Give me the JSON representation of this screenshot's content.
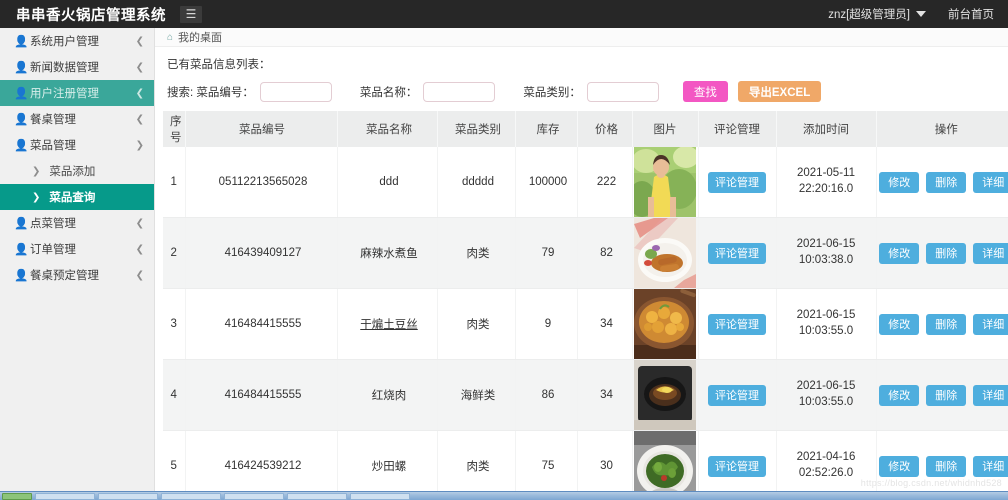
{
  "topbar": {
    "brand": "串串香火锅店管理系统",
    "menu_icon": "hamburger-icon",
    "user": "znz[超级管理员]",
    "front_page": "前台首页"
  },
  "sidebar": {
    "items": [
      {
        "label": "系统用户管理",
        "icon": "user-icon",
        "arrow": "❮",
        "state": "collapsed"
      },
      {
        "label": "新闻数据管理",
        "icon": "user-icon",
        "arrow": "❮",
        "state": "collapsed"
      },
      {
        "label": "用户注册管理",
        "icon": "user-icon",
        "arrow": "❮",
        "state": "hovered"
      },
      {
        "label": "餐桌管理",
        "icon": "user-icon",
        "arrow": "❮",
        "state": "collapsed"
      },
      {
        "label": "菜品管理",
        "icon": "user-icon",
        "arrow": "❯",
        "state": "expanded"
      }
    ],
    "sub_items": [
      {
        "label": "菜品添加",
        "arrow": "❯",
        "state": "normal"
      },
      {
        "label": "菜品查询",
        "arrow": "❯",
        "state": "active"
      }
    ],
    "items_after": [
      {
        "label": "点菜管理",
        "icon": "user-icon",
        "arrow": "❮",
        "state": "collapsed"
      },
      {
        "label": "订单管理",
        "icon": "user-icon",
        "arrow": "❮",
        "state": "collapsed"
      },
      {
        "label": "餐桌预定管理",
        "icon": "user-icon",
        "arrow": "❮",
        "state": "collapsed"
      }
    ]
  },
  "breadcrumb": {
    "home_icon": "home-icon",
    "text": "我的桌面"
  },
  "main": {
    "caption": "已有菜品信息列表：",
    "search": {
      "label_code": "搜索: 菜品编号：",
      "value_code": "",
      "label_name": "菜品名称：",
      "value_name": "",
      "label_type": "菜品类别：",
      "value_type": "",
      "find_label": "查找",
      "export_label": "导出EXCEL",
      "find_color": "#f357c3",
      "export_color": "#f0a868"
    },
    "table": {
      "headers": [
        "序号",
        "菜品编号",
        "菜品名称",
        "菜品类别",
        "库存",
        "价格",
        "图片",
        "评论管理",
        "添加时间",
        "操作"
      ],
      "comment_label": "评论管理",
      "ops": {
        "edit": "修改",
        "delete": "删除",
        "detail": "详细"
      },
      "rows": [
        {
          "idx": "1",
          "code": "05112213565028",
          "name": "ddd",
          "type": "ddddd",
          "stock": "100000",
          "price": "222",
          "image": "woman-in-yellow-outdoors-photo",
          "time_date": "2021-05-11",
          "time_clock": "22:20:16.0",
          "name_link": false
        },
        {
          "idx": "2",
          "code": "416439409127",
          "name": "麻辣水煮鱼",
          "type": "肉类",
          "stock": "79",
          "price": "82",
          "image": "fried-food-on-plate-photo",
          "time_date": "2021-06-15",
          "time_clock": "10:03:38.0",
          "name_link": false
        },
        {
          "idx": "3",
          "code": "416484415555",
          "name": "干煸土豆丝",
          "type": "肉类",
          "stock": "9",
          "price": "34",
          "image": "golden-fried-dish-in-bowl-photo",
          "time_date": "2021-06-15",
          "time_clock": "10:03:55.0",
          "name_link": true
        },
        {
          "idx": "4",
          "code": "416484415555",
          "name": "红烧肉",
          "type": "海鲜类",
          "stock": "86",
          "price": "34",
          "image": "dark-stone-pan-dish-photo",
          "time_date": "2021-06-15",
          "time_clock": "10:03:55.0",
          "name_link": false
        },
        {
          "idx": "5",
          "code": "416424539212",
          "name": "炒田螺",
          "type": "肉类",
          "stock": "75",
          "price": "30",
          "image": "green-vegetable-bowl-photo",
          "time_date": "2021-04-16",
          "time_clock": "02:52:26.0",
          "name_link": false
        }
      ]
    }
  },
  "watermark": "https://blog.csdn.net/whidnhd528",
  "colors": {
    "topbar_bg": "#272727",
    "sidebar_bg": "#f0f0f0",
    "menu_hover": "#3aa79a",
    "menu_active": "#069a8a",
    "button_blue": "#4eaede",
    "table_header": "#eceded"
  }
}
